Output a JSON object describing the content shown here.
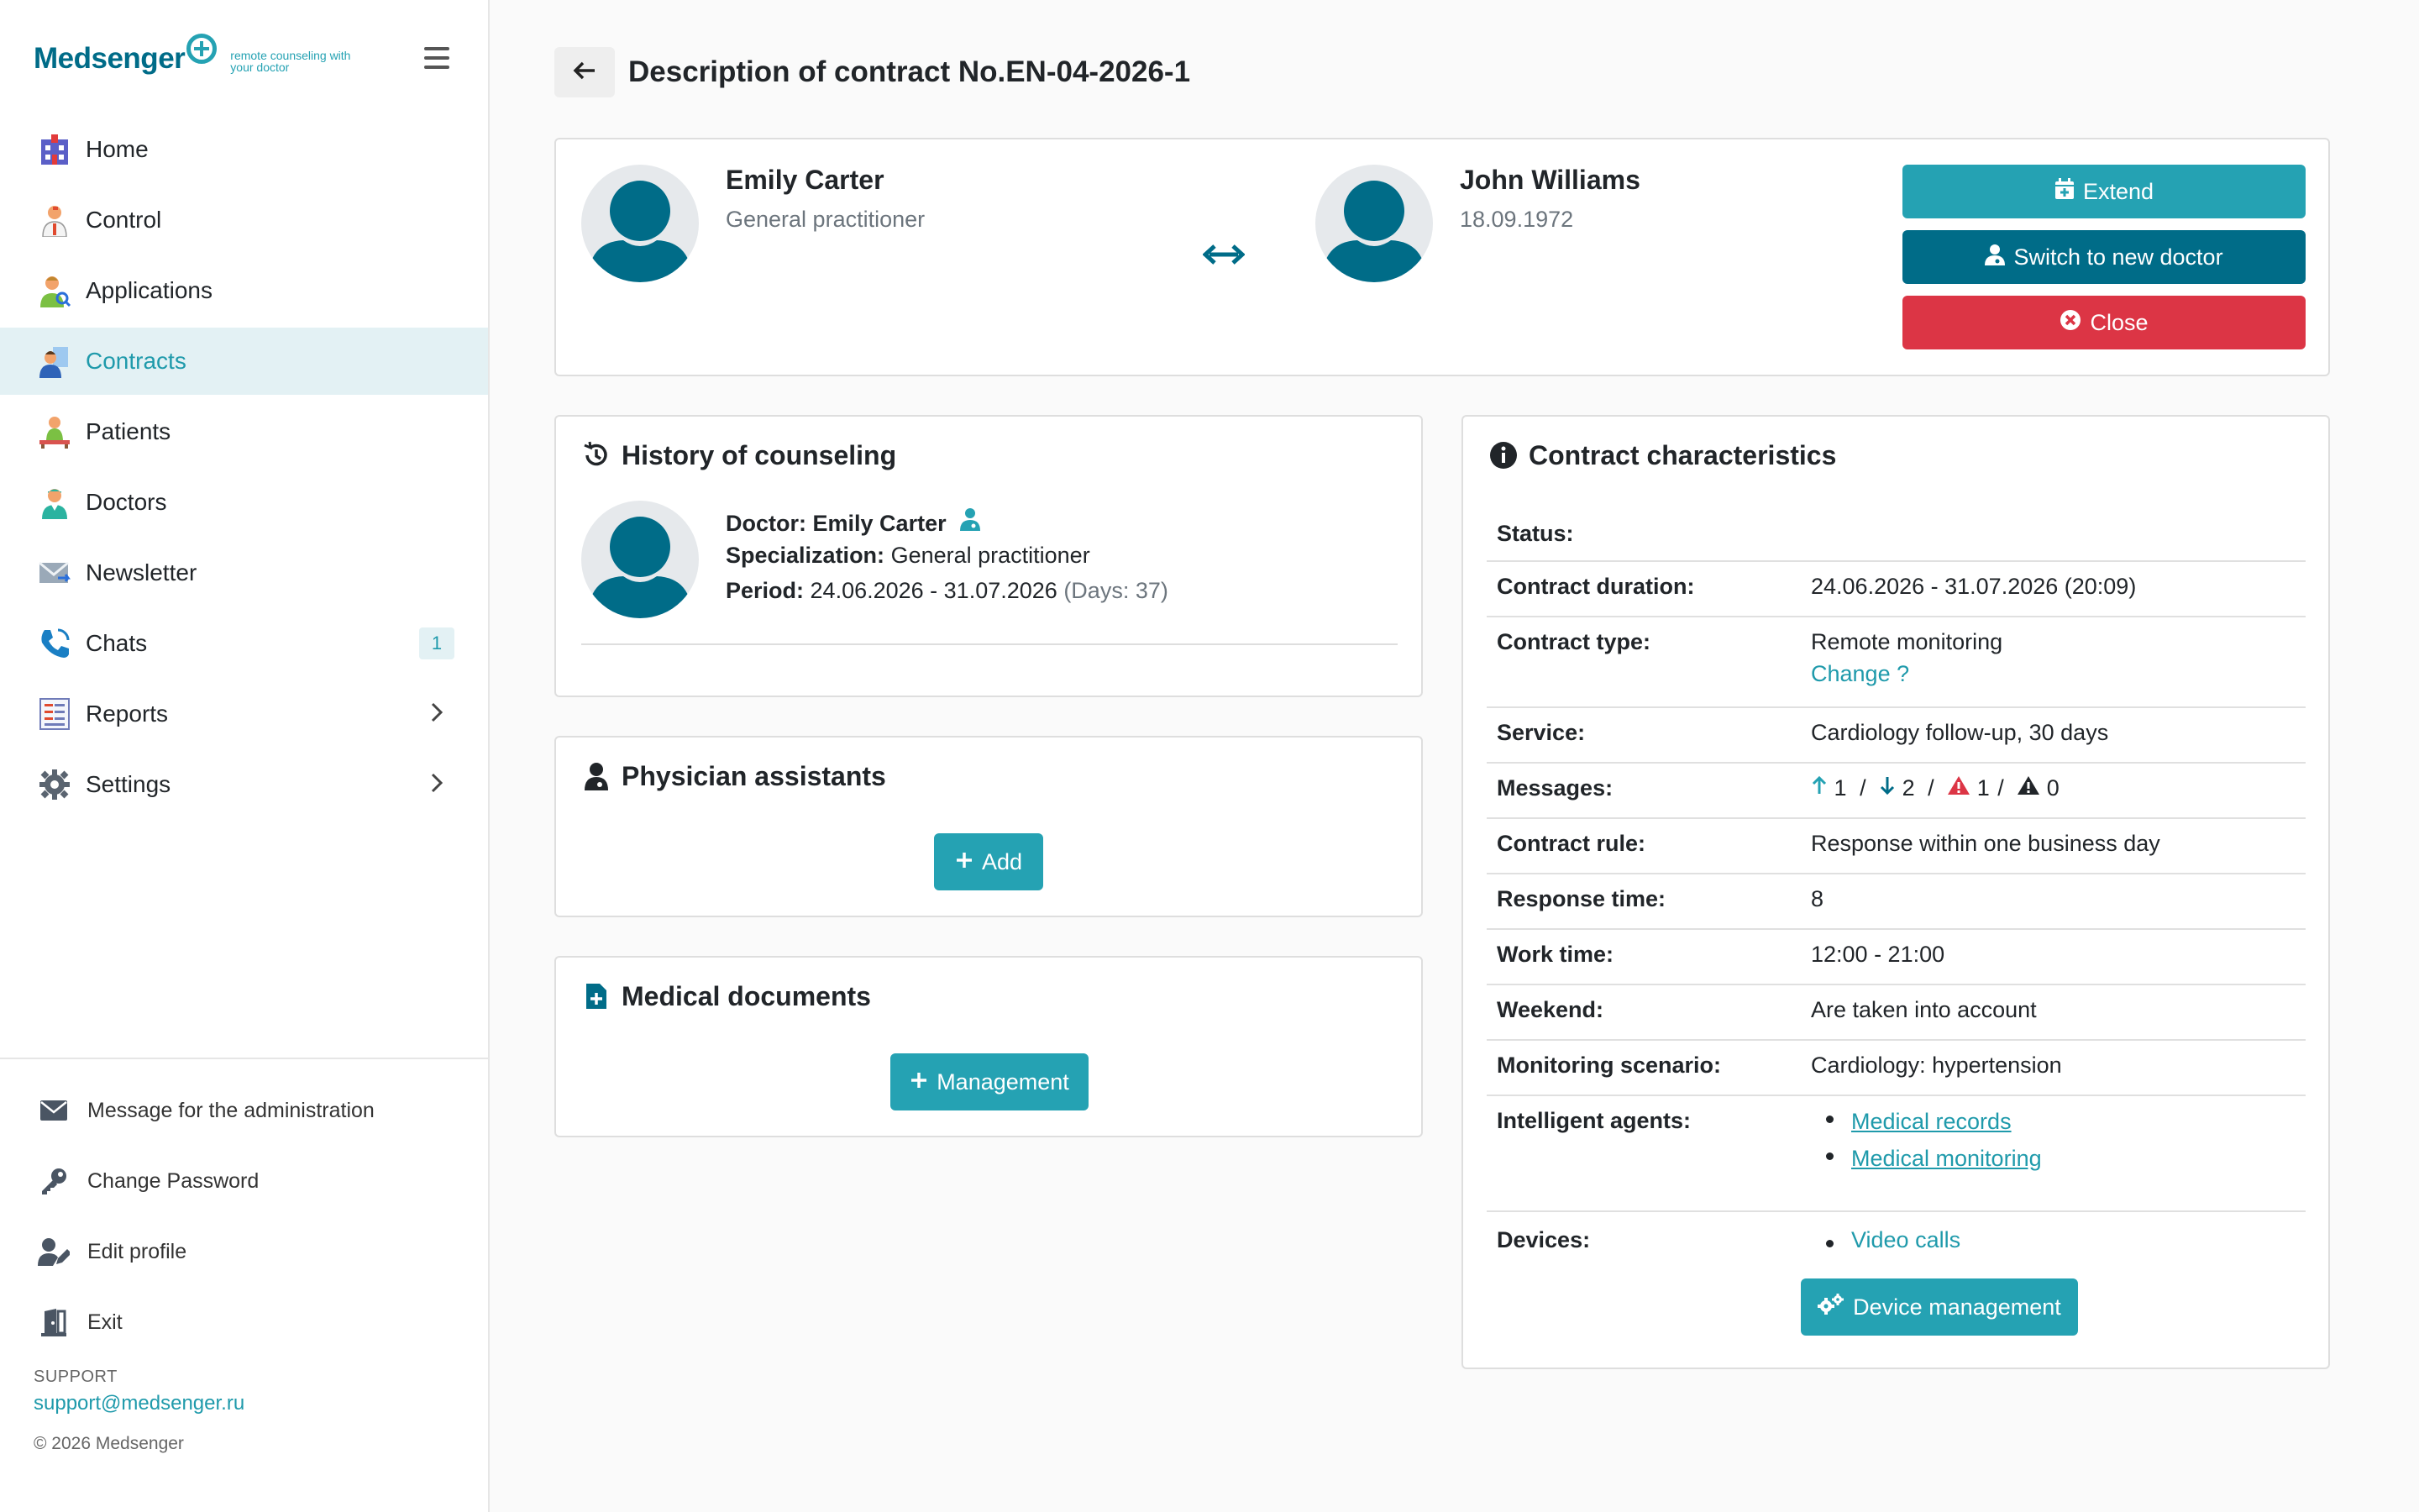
{
  "brand": {
    "name": "Medsenger",
    "tagline": "remote counseling with your doctor"
  },
  "sidebar": {
    "items": [
      {
        "label": "Home",
        "icon": "hospital-icon"
      },
      {
        "label": "Control",
        "icon": "control-person-icon"
      },
      {
        "label": "Applications",
        "icon": "applications-icon"
      },
      {
        "label": "Contracts",
        "icon": "contracts-icon",
        "active": true
      },
      {
        "label": "Patients",
        "icon": "patients-icon"
      },
      {
        "label": "Doctors",
        "icon": "doctor-icon"
      },
      {
        "label": "Newsletter",
        "icon": "newsletter-icon"
      },
      {
        "label": "Chats",
        "icon": "phone-icon",
        "badge": "1"
      },
      {
        "label": "Reports",
        "icon": "reports-icon",
        "has_submenu": true
      },
      {
        "label": "Settings",
        "icon": "gear-icon",
        "has_submenu": true
      }
    ],
    "footer_items": [
      {
        "label": "Message for the administration",
        "icon": "envelope-icon"
      },
      {
        "label": "Change Password",
        "icon": "key-icon"
      },
      {
        "label": "Edit profile",
        "icon": "user-edit-icon"
      },
      {
        "label": "Exit",
        "icon": "exit-door-icon"
      }
    ],
    "support_label": "SUPPORT",
    "support_email": "support@medsenger.ru",
    "copyright": "© 2026 Medsenger"
  },
  "page": {
    "title": "Description of contract No.EN-04-2026-1"
  },
  "parties": {
    "doctor": {
      "name": "Emily Carter",
      "subtitle": "General practitioner"
    },
    "patient": {
      "name": "John Williams",
      "subtitle": "18.09.1972"
    },
    "actions": {
      "extend": "Extend",
      "switch": "Switch to new doctor",
      "close": "Close"
    }
  },
  "history": {
    "title": "History of counseling",
    "doctor_label": "Doctor:",
    "doctor_value": "Emily Carter",
    "spec_label": "Specialization:",
    "spec_value": "General practitioner",
    "period_label": "Period:",
    "period_value": "24.06.2026 - 31.07.2026",
    "period_days": "(Days: 37)"
  },
  "assistants": {
    "title": "Physician assistants",
    "add_label": "Add"
  },
  "documents": {
    "title": "Medical documents",
    "manage_label": "Management"
  },
  "characteristics": {
    "title": "Contract characteristics",
    "status_label": "Status:",
    "duration_label": "Contract duration:",
    "duration_value": "24.06.2026 - 31.07.2026 (20:09)",
    "type_label": "Contract type:",
    "type_value": "Remote monitoring",
    "type_change": "Change ?",
    "service_label": "Service:",
    "service_value": "Cardiology follow-up, 30 days",
    "messages_label": "Messages:",
    "messages": {
      "incoming": "1",
      "outgoing": "2",
      "warnings": "1",
      "alerts": "0",
      "sep": "/"
    },
    "rule_label": "Contract rule:",
    "rule_value": "Response within one business day",
    "response_label": "Response time:",
    "response_value": "8",
    "work_label": "Work time:",
    "work_value": "12:00 - 21:00",
    "weekend_label": "Weekend:",
    "weekend_value": "Are taken into account",
    "scenario_label": "Monitoring scenario:",
    "scenario_value": "Cardiology: hypertension",
    "agents_label": "Intelligent agents:",
    "agents": [
      "Medical records",
      "Medical monitoring"
    ],
    "devices_label": "Devices:",
    "devices": [
      "Video calls"
    ],
    "device_button": "Device management"
  },
  "colors": {
    "teal": "#25a2b3",
    "dark_teal": "#006c88",
    "red": "#dc3545",
    "active_bg": "#e3f1f4"
  }
}
